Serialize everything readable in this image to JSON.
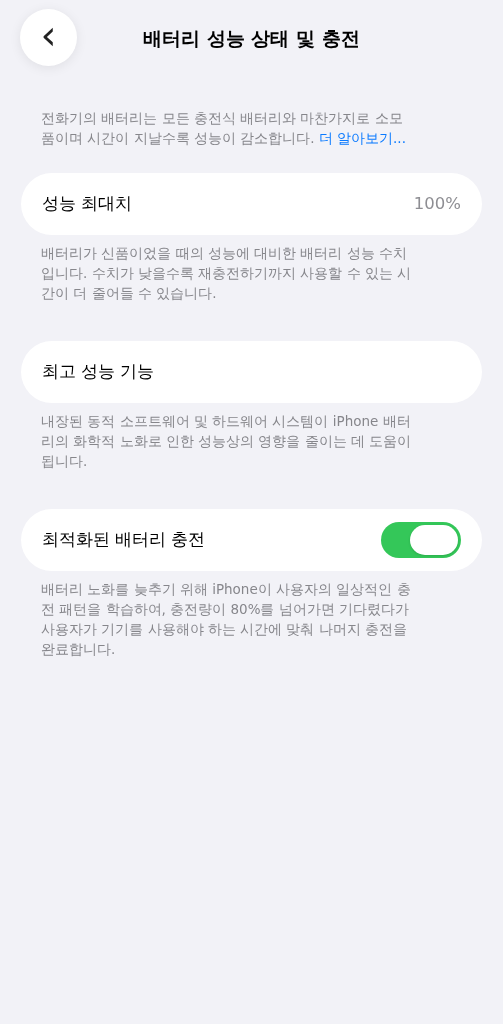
{
  "nav": {
    "back": "‹",
    "title": "배터리 성능 상태 및 충전"
  },
  "intro": {
    "text": "전화기의 배터리는 모든 충전식 배터리와 마찬가지로 소모품이며 시간이 지날수록 성능이 감소합니다.",
    "link": "더 알아보기..."
  },
  "sections": [
    {
      "kind": "value",
      "label": "성능 최대치",
      "value": "100%",
      "footer": "배터리가 신품이었을 때의 성능에 대비한 배터리 성능 수치입니다. 수치가 낮을수록 재충전하기까지 사용할 수 있는 시간이 더 줄어들 수 있습니다."
    },
    {
      "kind": "plain",
      "label": "최고 성능 기능",
      "footer": "내장된 동적 소프트웨어 및 하드웨어 시스템이 iPhone 배터리의 화학적 노화로 인한 성능상의 영향을 줄이는 데 도움이 됩니다."
    },
    {
      "kind": "toggle",
      "label": "최적화된 배터리 충전",
      "on": true,
      "footer": "배터리 노화를 늦추기 위해 iPhone이 사용자의 일상적인 충전 패턴을 학습하여, 충전량이 80%를 넘어가면 기다렸다가 사용자가 기기를 사용해야 하는 시간에 맞춰 나머지 충전을 완료합니다."
    }
  ]
}
